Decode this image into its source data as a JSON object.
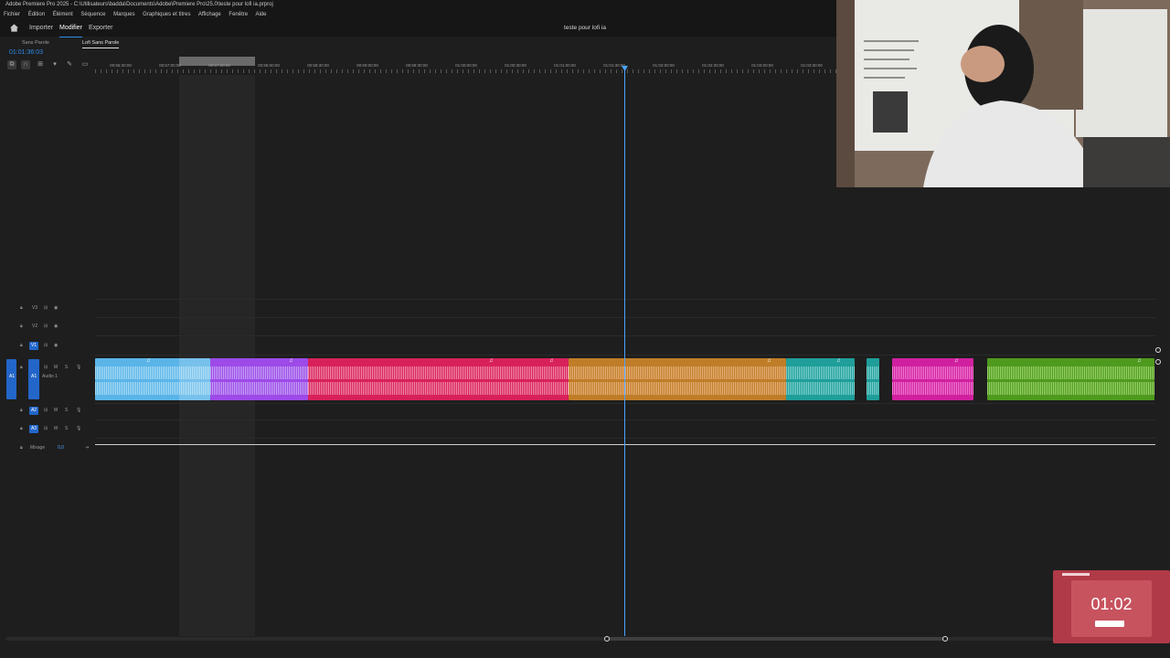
{
  "window": {
    "title": "Adobe Premiere Pro 2025 - C:\\Utilisateurs\\badda\\Documents\\Adobe\\Premiere Pro\\25.0\\teste pour lofi ia.prproj"
  },
  "menu": [
    "Fichier",
    "Édition",
    "Élément",
    "Séquence",
    "Marques",
    "Graphiques et titres",
    "Affichage",
    "Fenêtre",
    "Aide"
  ],
  "workspace": {
    "tabs": [
      "Importer",
      "Modifier",
      "Exporter"
    ],
    "active": "Modifier",
    "project_title": "teste pour lofi ia"
  },
  "sequence_tabs": [
    "Sans Parole",
    "Lofi Sans Parole"
  ],
  "timeline": {
    "timecode": "01:01:36:03",
    "ruler": [
      "00:56:30:00",
      "00:57:00:00",
      "00:57:30:00",
      "00:58:00:00",
      "00:58:30:00",
      "00:59:00:00",
      "00:59:30:00",
      "01:00:00:00",
      "01:00:30:00",
      "01:01:00:00",
      "01:01:30:00",
      "01:02:00:00",
      "01:02:30:00",
      "01:03:00:00",
      "01:03:30:00"
    ],
    "tracks": {
      "v3": "V3",
      "v2": "V2",
      "v1": "V1",
      "a1": "A1",
      "a1_name": "Audio 1",
      "a2": "A2",
      "a3": "A3",
      "mix_label": "Mixage",
      "mix_value": "0,0",
      "mute": "M",
      "solo": "S"
    },
    "audio_clips": [
      {
        "color": "#5ab4e8",
        "wave": "#a9dcf5"
      },
      {
        "color": "#9d4ae8",
        "wave": "#c6a3f5"
      },
      {
        "color": "#d8215a",
        "wave": "#f08aa8"
      },
      {
        "color": "#c07d28",
        "wave": "#e7b07a"
      },
      {
        "color": "#1f9e9a",
        "wave": "#7fd1cf"
      },
      {
        "color": "#1f9e9a",
        "wave": "#7fd1cf"
      },
      {
        "color": "#d0209f",
        "wave": "#f07ad0"
      },
      {
        "color": "#4e9a1e",
        "wave": "#9bd36b"
      }
    ]
  },
  "pip_timer": {
    "time": "01:02"
  }
}
